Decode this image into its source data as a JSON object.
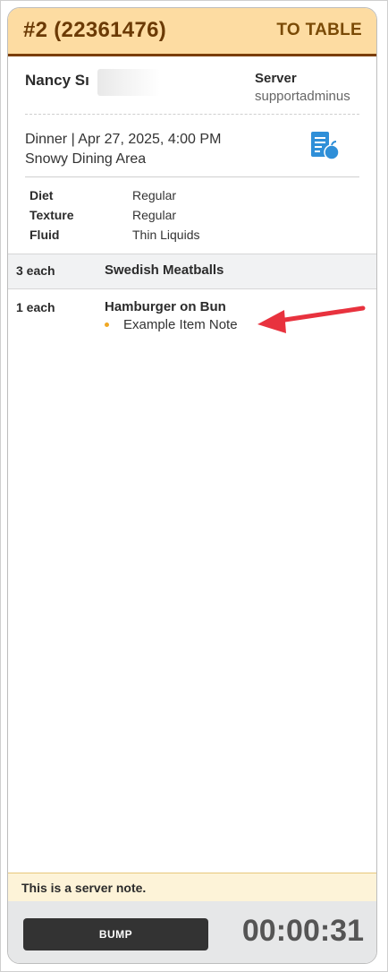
{
  "header": {
    "ticket_number": "#2 (22361476)",
    "to_table_label": "TO TABLE",
    "accent_color": "#fddca2"
  },
  "guest": {
    "name": "Nancy Sı",
    "server_label": "Server",
    "server_name": "supportadminus"
  },
  "meal": {
    "info": "Dinner | Apr 27, 2025, 4:00 PM",
    "area": "Snowy Dining Area",
    "icon": "menu-document-icon"
  },
  "attributes": [
    {
      "label": "Diet",
      "value": "Regular"
    },
    {
      "label": "Texture",
      "value": "Regular"
    },
    {
      "label": "Fluid",
      "value": "Thin Liquids"
    }
  ],
  "items": [
    {
      "qty": "3 each",
      "name": "Swedish Meatballs"
    },
    {
      "qty": "1 each",
      "name": "Hamburger on Bun",
      "note": "Example Item Note"
    }
  ],
  "server_note": "This is a server note.",
  "footer": {
    "bump_label": "BUMP",
    "timer": "00:00:31"
  }
}
